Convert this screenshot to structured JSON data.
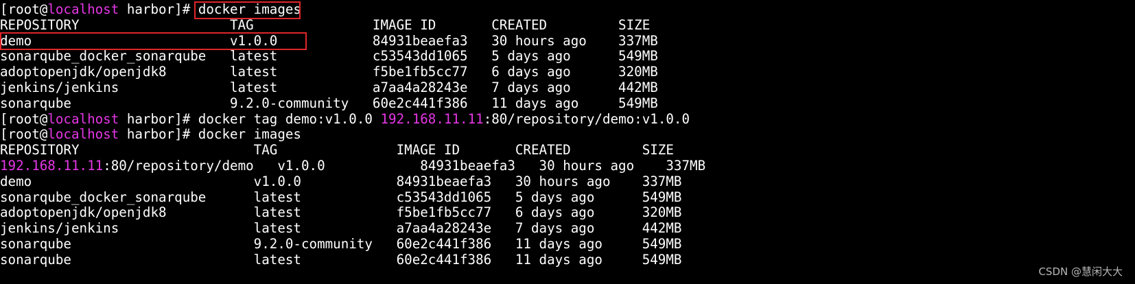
{
  "terminal": {
    "colors": {
      "background": "#000000",
      "text": "#ffffff",
      "accent": "#e637e6",
      "highlight_box": "#e0262a"
    },
    "lines": [
      {
        "segments": [
          {
            "text": "[root@",
            "color": "white"
          },
          {
            "text": "localhost",
            "color": "pink"
          },
          {
            "text": " harbor]# ",
            "color": "white"
          },
          {
            "text": "docker images",
            "color": "white"
          }
        ]
      },
      {
        "segments": [
          {
            "text": "REPOSITORY                   TAG               IMAGE ID       CREATED         SIZE",
            "color": "white"
          }
        ]
      },
      {
        "segments": [
          {
            "text": "demo                         v1.0.0            84931beaefa3   30 hours ago    337MB",
            "color": "white"
          }
        ]
      },
      {
        "segments": [
          {
            "text": "sonarqube_docker_sonarqube   latest            c53543dd1065   5 days ago      549MB",
            "color": "white"
          }
        ]
      },
      {
        "segments": [
          {
            "text": "adoptopenjdk/openjdk8        latest            f5be1fb5cc77   6 days ago      320MB",
            "color": "white"
          }
        ]
      },
      {
        "segments": [
          {
            "text": "jenkins/jenkins              latest            a7aa4a28243e   7 days ago      442MB",
            "color": "white"
          }
        ]
      },
      {
        "segments": [
          {
            "text": "sonarqube                    9.2.0-community   60e2c441f386   11 days ago     549MB",
            "color": "white"
          }
        ]
      },
      {
        "segments": [
          {
            "text": "[root@",
            "color": "white"
          },
          {
            "text": "localhost",
            "color": "pink"
          },
          {
            "text": " harbor]# docker tag demo:v1.0.0 ",
            "color": "white"
          },
          {
            "text": "192.168.11.11",
            "color": "pink"
          },
          {
            "text": ":80/repository/demo:v1.0.0",
            "color": "white"
          }
        ]
      },
      {
        "segments": [
          {
            "text": "[root@",
            "color": "white"
          },
          {
            "text": "localhost",
            "color": "pink"
          },
          {
            "text": " harbor]# docker images",
            "color": "white"
          }
        ]
      },
      {
        "segments": [
          {
            "text": "REPOSITORY                      TAG               IMAGE ID       CREATED         SIZE",
            "color": "white"
          }
        ]
      },
      {
        "segments": [
          {
            "text": "192.168.11.11",
            "color": "pink"
          },
          {
            "text": ":80/repository/demo   v1.0.0            84931beaefa3   30 hours ago    337MB",
            "color": "white"
          }
        ]
      },
      {
        "segments": [
          {
            "text": "demo                            v1.0.0            84931beaefa3   30 hours ago    337MB",
            "color": "white"
          }
        ]
      },
      {
        "segments": [
          {
            "text": "sonarqube_docker_sonarqube      latest            c53543dd1065   5 days ago      549MB",
            "color": "white"
          }
        ]
      },
      {
        "segments": [
          {
            "text": "adoptopenjdk/openjdk8           latest            f5be1fb5cc77   6 days ago      320MB",
            "color": "white"
          }
        ]
      },
      {
        "segments": [
          {
            "text": "jenkins/jenkins                 latest            a7aa4a28243e   7 days ago      442MB",
            "color": "white"
          }
        ]
      },
      {
        "segments": [
          {
            "text": "sonarqube                       9.2.0-community   60e2c441f386   11 days ago     549MB",
            "color": "white"
          }
        ]
      },
      {
        "segments": [
          {
            "text": "sonarqube                       latest            60e2c441f386   11 days ago     549MB",
            "color": "white"
          }
        ]
      }
    ]
  },
  "watermark": "CSDN @慧闲大大"
}
